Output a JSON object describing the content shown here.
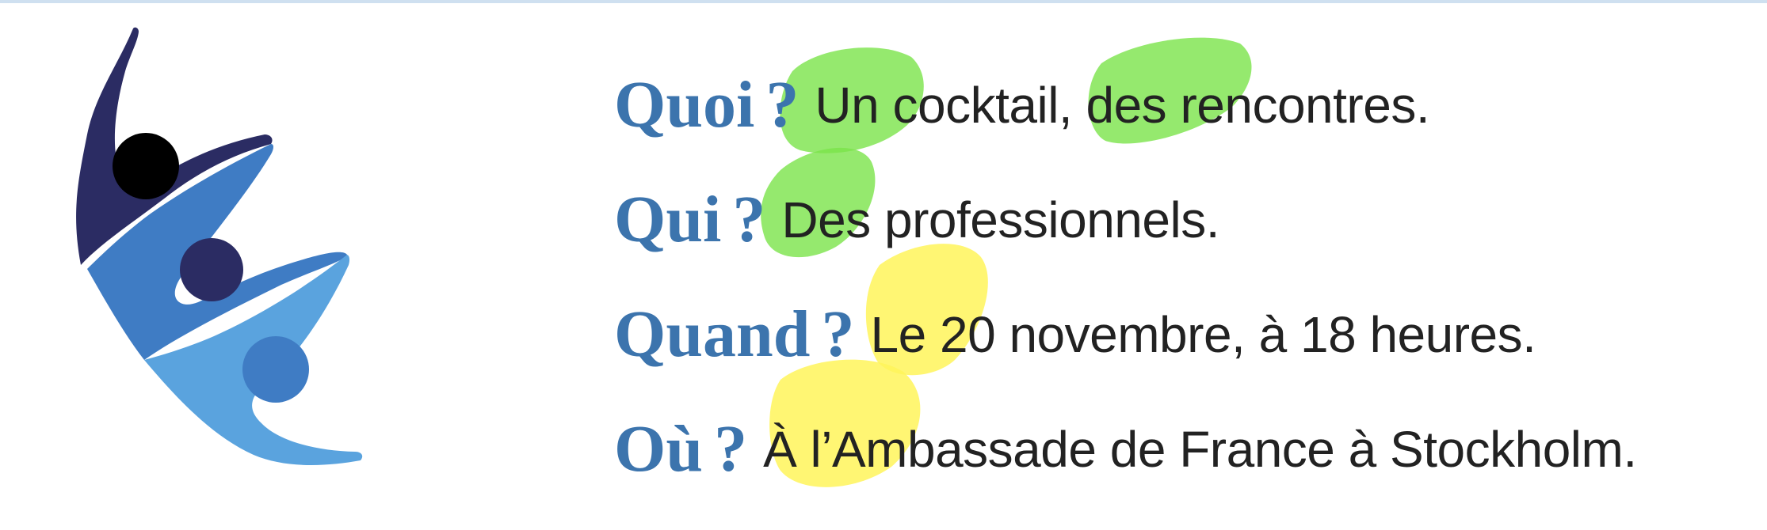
{
  "lines": [
    {
      "question": "Quoi",
      "mark": "?",
      "answer": "Un cocktail, des rencontres."
    },
    {
      "question": "Qui",
      "mark": "?",
      "answer": "Des professionnels."
    },
    {
      "question": "Quand",
      "mark": "?",
      "answer": "Le 20 novembre, à 18 heures."
    },
    {
      "question": "Où",
      "mark": "?",
      "answer": "À l’Ambassade de France à Stockholm."
    }
  ],
  "colors": {
    "question": "#3c74ad",
    "answer": "#222222",
    "highlight_green": "#7be34a",
    "highlight_yellow": "#fff45a",
    "logo_navy": "#2b2c63",
    "logo_blue": "#3f7cc4",
    "logo_light_blue": "#5aa3de",
    "logo_black": "#000000"
  },
  "logo": {
    "icon": "three-leaping-figures-logo"
  }
}
